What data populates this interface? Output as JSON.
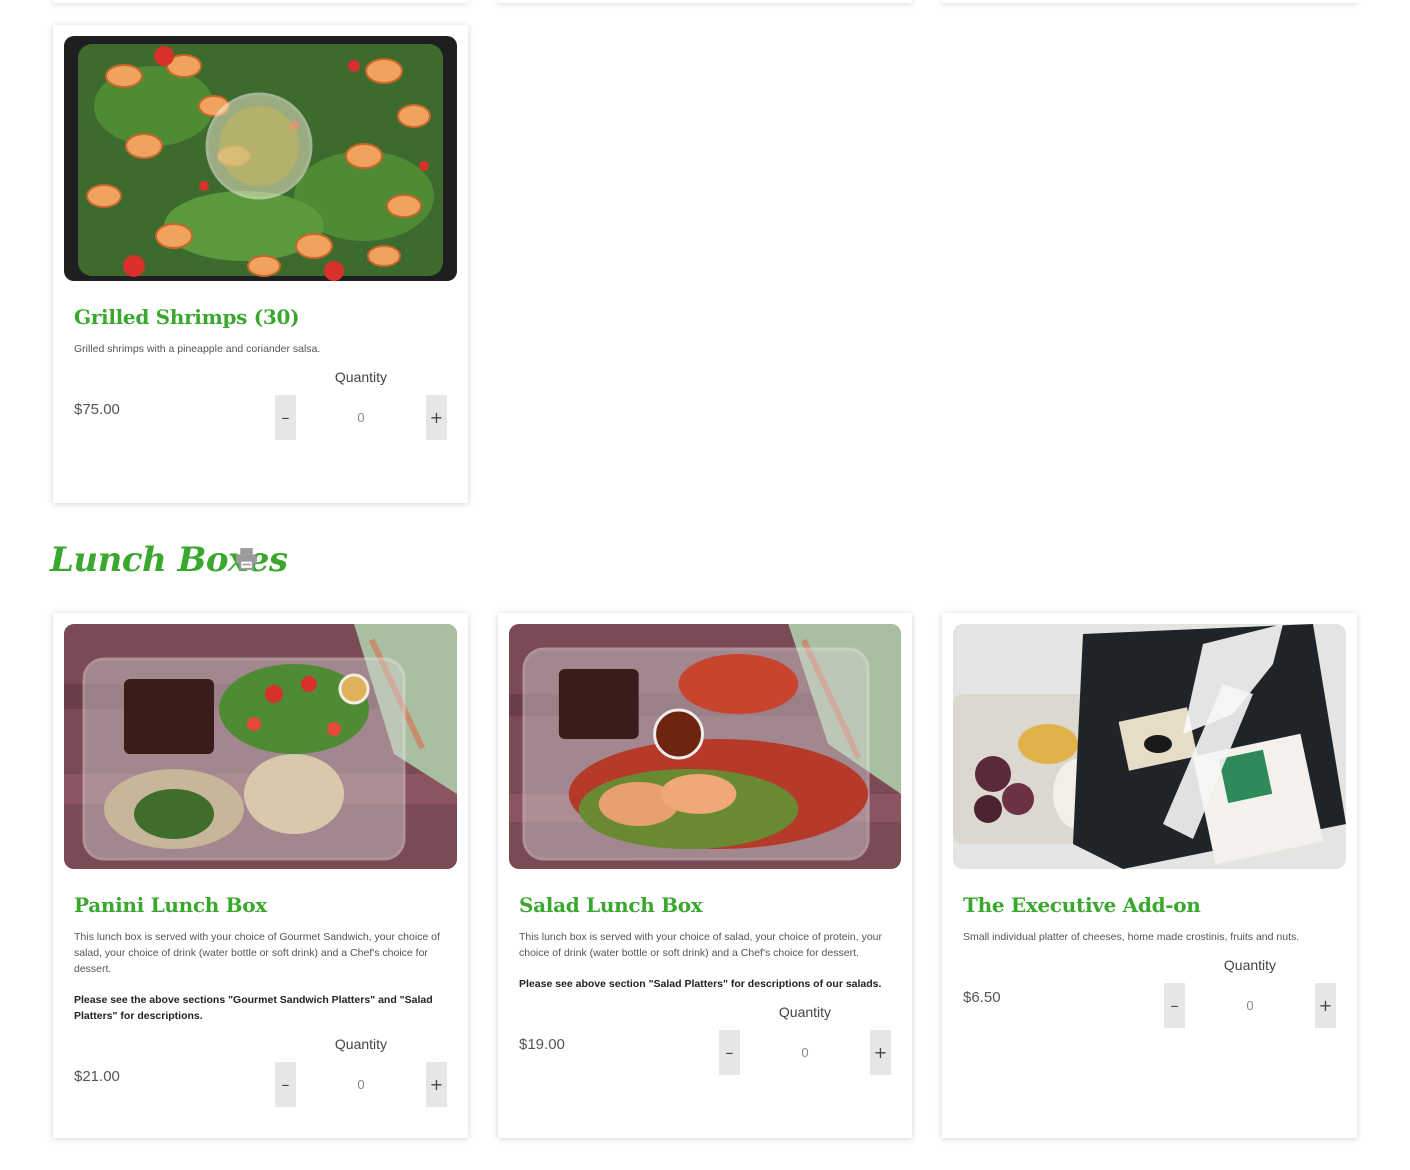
{
  "colors": {
    "accent": "#3aa82e",
    "text": "#555555",
    "button_bg": "#e6e6e6"
  },
  "section": {
    "title": "Lunch Boxes",
    "print_icon": "print-icon"
  },
  "stepper": {
    "minus": "–",
    "plus": "+"
  },
  "products": [
    {
      "title": "Grilled Shrimps (30)",
      "description": "Grilled shrimps with a pineapple and coriander salsa.",
      "note": "",
      "price": "$75.00",
      "quantity_label": "Quantity",
      "quantity": "0"
    },
    {
      "title": "Panini Lunch Box",
      "description": "This lunch box is served with your choice of Gourmet Sandwich, your choice of salad, your choice of drink (water bottle or soft drink) and a Chef's choice for dessert.",
      "note": "Please see the above sections \"Gourmet Sandwich Platters\" and \"Salad Platters\" for descriptions.",
      "price": "$21.00",
      "quantity_label": "Quantity",
      "quantity": "0"
    },
    {
      "title": "Salad Lunch Box",
      "description": "This lunch box is served with your choice of salad, your choice of protein, your choice of drink (water bottle or soft drink) and a Chef's choice for dessert.",
      "note": "Please see above section \"Salad Platters\" for descriptions of our salads.",
      "price": "$19.00",
      "quantity_label": "Quantity",
      "quantity": "0"
    },
    {
      "title": "The Executive Add-on",
      "description": "Small individual platter of cheeses, home made crostinis, fruits and nuts.",
      "note": "",
      "price": "$6.50",
      "quantity_label": "Quantity",
      "quantity": "0"
    }
  ]
}
